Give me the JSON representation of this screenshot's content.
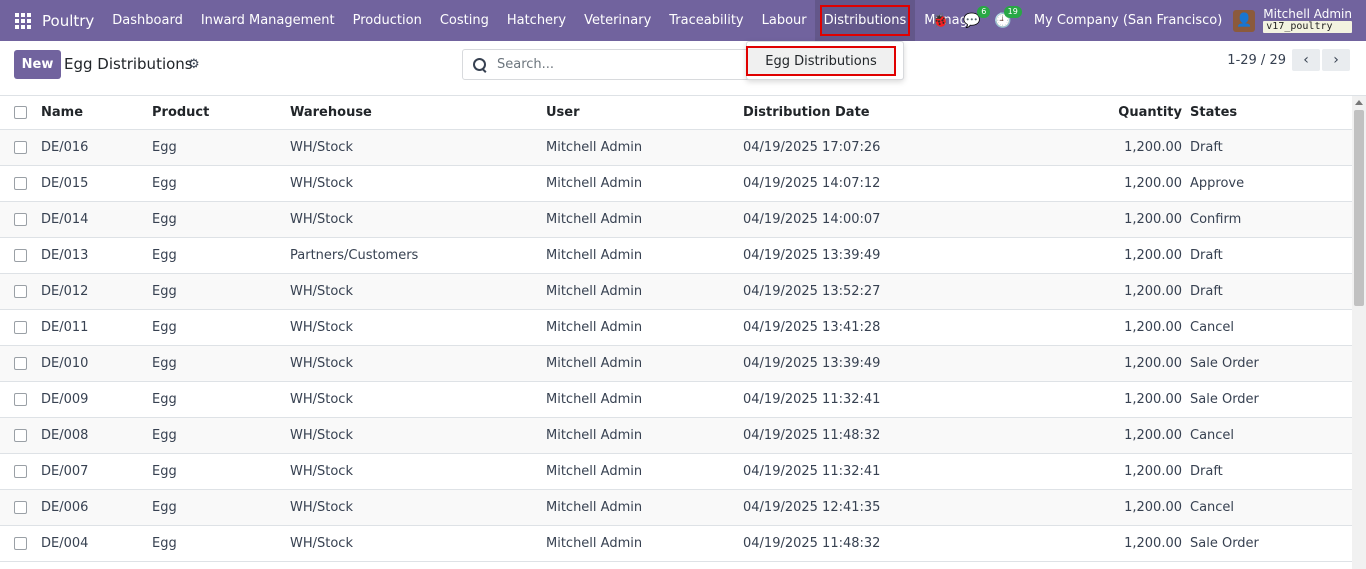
{
  "navbar": {
    "brand": "Poultry",
    "menu": [
      "Dashboard",
      "Inward Management",
      "Production",
      "Costing",
      "Hatchery",
      "Veterinary",
      "Traceability",
      "Labour",
      "Distributions",
      "Manage"
    ],
    "active_menu": "Distributions",
    "messages_count": "6",
    "activities_count": "19",
    "company": "My Company (San Francisco)",
    "user_name": "Mitchell Admin",
    "db_name": "v17_poultry"
  },
  "dropdown": {
    "items": [
      "Egg Distributions"
    ]
  },
  "control": {
    "new_label": "New",
    "title": "Egg Distributions",
    "search_placeholder": "Search...",
    "pager": "1-29 / 29"
  },
  "table": {
    "columns": [
      "Name",
      "Product",
      "Warehouse",
      "User",
      "Distribution Date",
      "Quantity",
      "States"
    ],
    "rows": [
      [
        "DE/016",
        "Egg",
        "WH/Stock",
        "Mitchell Admin",
        "04/19/2025 17:07:26",
        "1,200.00",
        "Draft"
      ],
      [
        "DE/015",
        "Egg",
        "WH/Stock",
        "Mitchell Admin",
        "04/19/2025 14:07:12",
        "1,200.00",
        "Approve"
      ],
      [
        "DE/014",
        "Egg",
        "WH/Stock",
        "Mitchell Admin",
        "04/19/2025 14:00:07",
        "1,200.00",
        "Confirm"
      ],
      [
        "DE/013",
        "Egg",
        "Partners/Customers",
        "Mitchell Admin",
        "04/19/2025 13:39:49",
        "1,200.00",
        "Draft"
      ],
      [
        "DE/012",
        "Egg",
        "WH/Stock",
        "Mitchell Admin",
        "04/19/2025 13:52:27",
        "1,200.00",
        "Draft"
      ],
      [
        "DE/011",
        "Egg",
        "WH/Stock",
        "Mitchell Admin",
        "04/19/2025 13:41:28",
        "1,200.00",
        "Cancel"
      ],
      [
        "DE/010",
        "Egg",
        "WH/Stock",
        "Mitchell Admin",
        "04/19/2025 13:39:49",
        "1,200.00",
        "Sale Order"
      ],
      [
        "DE/009",
        "Egg",
        "WH/Stock",
        "Mitchell Admin",
        "04/19/2025 11:32:41",
        "1,200.00",
        "Sale Order"
      ],
      [
        "DE/008",
        "Egg",
        "WH/Stock",
        "Mitchell Admin",
        "04/19/2025 11:48:32",
        "1,200.00",
        "Cancel"
      ],
      [
        "DE/007",
        "Egg",
        "WH/Stock",
        "Mitchell Admin",
        "04/19/2025 11:32:41",
        "1,200.00",
        "Draft"
      ],
      [
        "DE/006",
        "Egg",
        "WH/Stock",
        "Mitchell Admin",
        "04/19/2025 12:41:35",
        "1,200.00",
        "Cancel"
      ],
      [
        "DE/004",
        "Egg",
        "WH/Stock",
        "Mitchell Admin",
        "04/19/2025 11:48:32",
        "1,200.00",
        "Sale Order"
      ]
    ]
  },
  "colors": {
    "brand": "#71639e",
    "highlight": "#e00000",
    "badge": "#28a745"
  }
}
